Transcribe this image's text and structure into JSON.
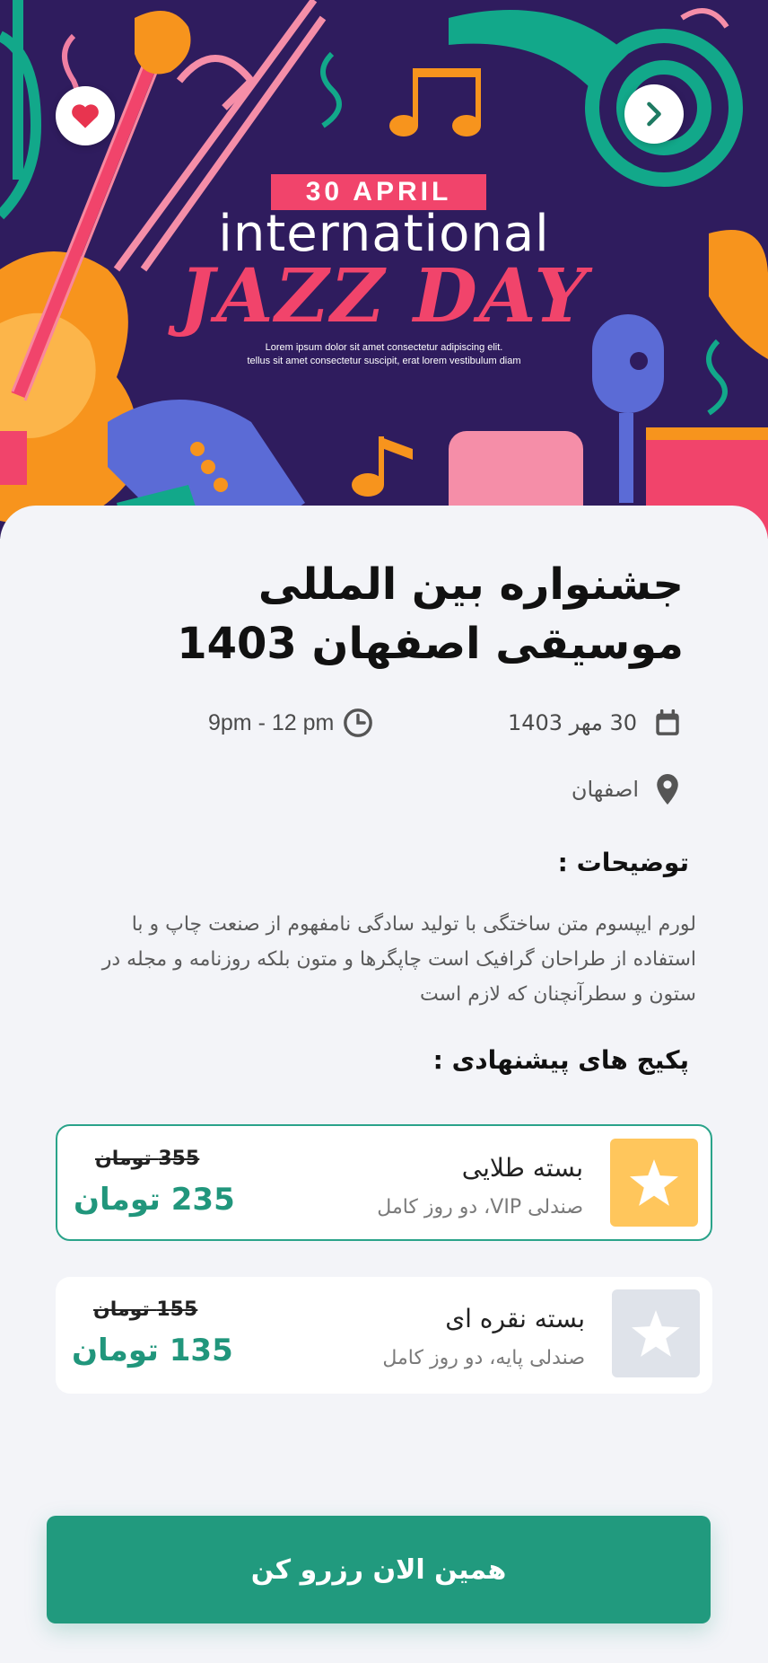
{
  "hero": {
    "date_badge": "30 APRIL",
    "subtitle": "international",
    "headline": "JAZZ DAY",
    "lorem_line1": "Lorem ipsum dolor sit amet consectetur adipiscing elit.",
    "lorem_line2": "tellus sit amet consectetur suscipit, erat lorem vestibulum diam",
    "favorite_icon": "heart-icon",
    "next_icon": "chevron-right-icon"
  },
  "event": {
    "title": "جشنواره بین المللی موسیقی اصفهان 1403",
    "date": "30 مهر 1403",
    "time": "9pm - 12 pm",
    "location": "اصفهان"
  },
  "description": {
    "heading": "توضیحات :",
    "text": "لورم ایپسوم متن ساختگی با تولید سادگی نامفهوم از صنعت چاپ و با استفاده از طراحان گرافیک است چاپگرها و متون بلکه روزنامه و مجله در ستون و سطرآنچنان که لازم است"
  },
  "packages": {
    "heading": "پکیج های پیشنهادی :",
    "items": [
      {
        "name": "بسته طلایی",
        "details": "صندلی VIP، دو روز کامل",
        "old_price": "355 تومان",
        "price": "235 تومان",
        "icon": "star-icon",
        "selected": true,
        "icon_bg": "#ffc65c"
      },
      {
        "name": "بسته نقره ای",
        "details": "صندلی پایه، دو روز کامل",
        "old_price": "155 تومان",
        "price": "135 تومان",
        "icon": "star-icon",
        "selected": false,
        "icon_bg": "#dfe3ea"
      }
    ]
  },
  "cta": {
    "label": "همین الان رزرو کن"
  },
  "colors": {
    "accent": "#219a7e",
    "hero_bg": "#2f1c5e",
    "hero_pink": "#f1446b",
    "gold": "#ffc65c"
  }
}
